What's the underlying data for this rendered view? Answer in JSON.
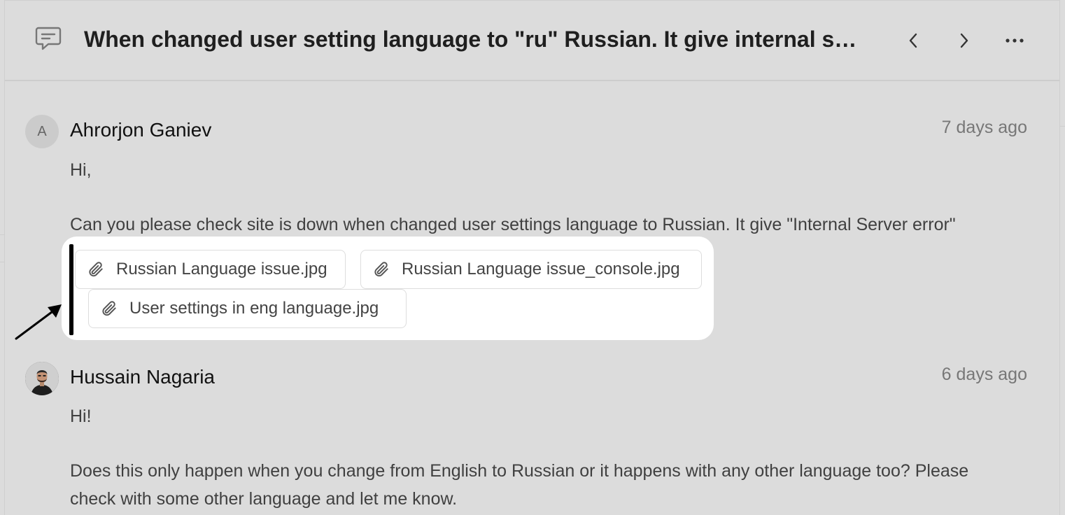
{
  "header": {
    "title": "When changed user setting language to \"ru\" Russian. It give internal server error",
    "icon": "comment-icon",
    "prev_icon": "chevron-left-icon",
    "next_icon": "chevron-right-icon",
    "more_icon": "more-horizontal-icon"
  },
  "messages": [
    {
      "avatar_initial": "A",
      "author": "Ahrorjon Ganiev",
      "time": "7 days ago",
      "lines": [
        "Hi,",
        "Can you please check site is down when changed user settings language to Russian. It give \"Internal Server error\""
      ],
      "attachments": [
        {
          "name": "Russian Language issue.jpg",
          "icon": "paperclip-icon"
        },
        {
          "name": "Russian Language issue_console.jpg",
          "icon": "paperclip-icon"
        },
        {
          "name": "User settings in eng language.jpg",
          "icon": "paperclip-icon"
        }
      ]
    },
    {
      "avatar_initial": "",
      "author": "Hussain Nagaria",
      "time": "6 days ago",
      "lines": [
        "Hi!",
        "Does this only happen when you change from English to Russian or it happens with any other language too? Please",
        "check with some other language and let me know."
      ]
    }
  ],
  "colors": {
    "background": "#dcdcdc",
    "highlight": "#ffffff",
    "marker": "#000000"
  }
}
